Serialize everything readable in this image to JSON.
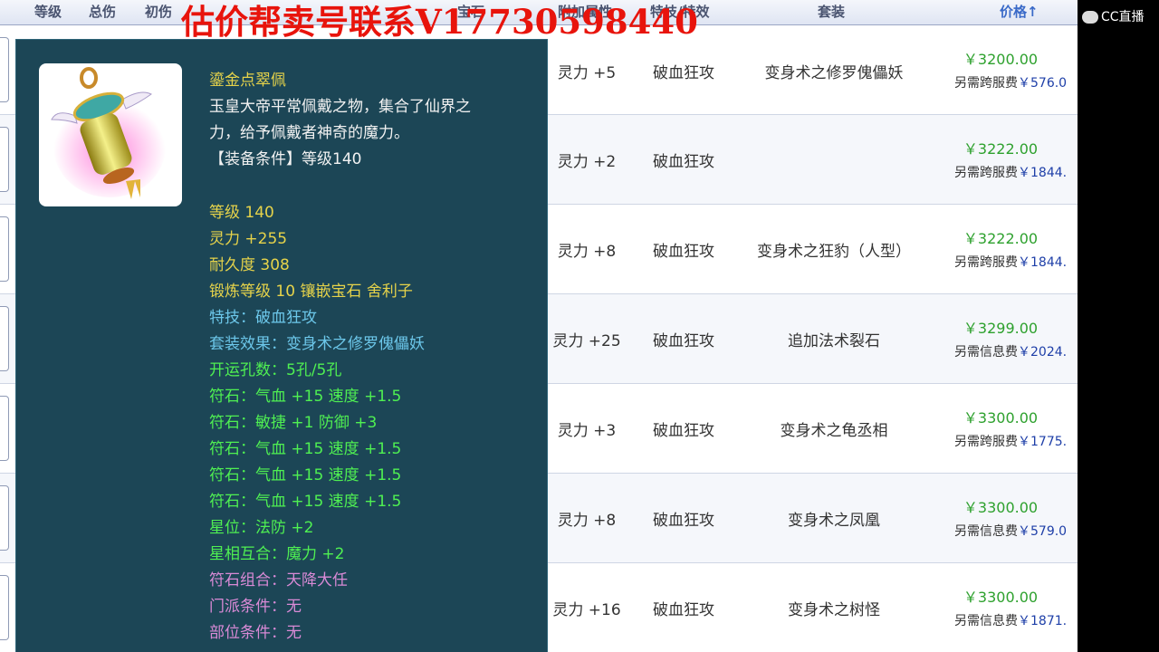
{
  "header": {
    "cols": [
      "等级",
      "总伤",
      "初伤",
      "",
      "",
      "",
      "",
      "宝石",
      "附加属性",
      "特技/特效"
    ],
    "set_label": "套装",
    "price_label": "价格↑"
  },
  "watermark": "估价帮卖号联系V17730598440",
  "cc_logo": "CC直播",
  "rows": [
    {
      "attr": "灵力 +5",
      "skill": "破血狂攻",
      "set": "变身术之修罗傀儡妖",
      "price": "￥3200.00",
      "fee_label": "另需跨服费",
      "fee": "￥576.0"
    },
    {
      "attr": "灵力 +2",
      "skill": "破血狂攻",
      "set": "",
      "price": "￥3222.00",
      "fee_label": "另需跨服费",
      "fee": "￥1844."
    },
    {
      "attr": "灵力 +8",
      "skill": "破血狂攻",
      "set": "变身术之狂豹（人型）",
      "price": "￥3222.00",
      "fee_label": "另需跨服费",
      "fee": "￥1844."
    },
    {
      "attr": "灵力 +25",
      "skill": "破血狂攻",
      "set": "追加法术裂石",
      "price": "￥3299.00",
      "fee_label": "另需信息费",
      "fee": "￥2024."
    },
    {
      "attr": "灵力 +3",
      "skill": "破血狂攻",
      "set": "变身术之龟丞相",
      "price": "￥3300.00",
      "fee_label": "另需跨服费",
      "fee": "￥1775."
    },
    {
      "attr": "灵力 +8",
      "skill": "破血狂攻",
      "set": "变身术之凤凰",
      "price": "￥3300.00",
      "fee_label": "另需信息费",
      "fee": "￥579.0"
    },
    {
      "attr": "灵力 +16",
      "skill": "破血狂攻",
      "set": "变身术之树怪",
      "price": "￥3300.00",
      "fee_label": "另需信息费",
      "fee": "￥1871."
    }
  ],
  "tooltip": {
    "name": "鎏金点翠佩",
    "desc1": "玉皇大帝平常佩戴之物，集合了仙界之",
    "desc2": "力，给予佩戴者神奇的魔力。",
    "req": "【装备条件】等级140",
    "level": "等级 140",
    "spirit": "灵力 +255",
    "durability": "耐久度 308",
    "forge": "锻炼等级 10 镶嵌宝石 舍利子",
    "special": "特技：破血狂攻",
    "set_effect": "套装效果：变身术之修罗傀儡妖",
    "holes": "开运孔数：5孔/5孔",
    "rune1": "符石：气血 +15 速度 +1.5",
    "rune2": "符石：敏捷 +1 防御 +3",
    "rune3": "符石：气血 +15 速度 +1.5",
    "rune4": "符石：气血 +15 速度 +1.5",
    "rune5": "符石：气血 +15 速度 +1.5",
    "star": "星位：法防 +2",
    "star_combo": "星相互合：魔力 +2",
    "rune_combo": "符石组合：天降大任",
    "school_req": "门派条件：无",
    "slot_req": "部位条件：无"
  }
}
